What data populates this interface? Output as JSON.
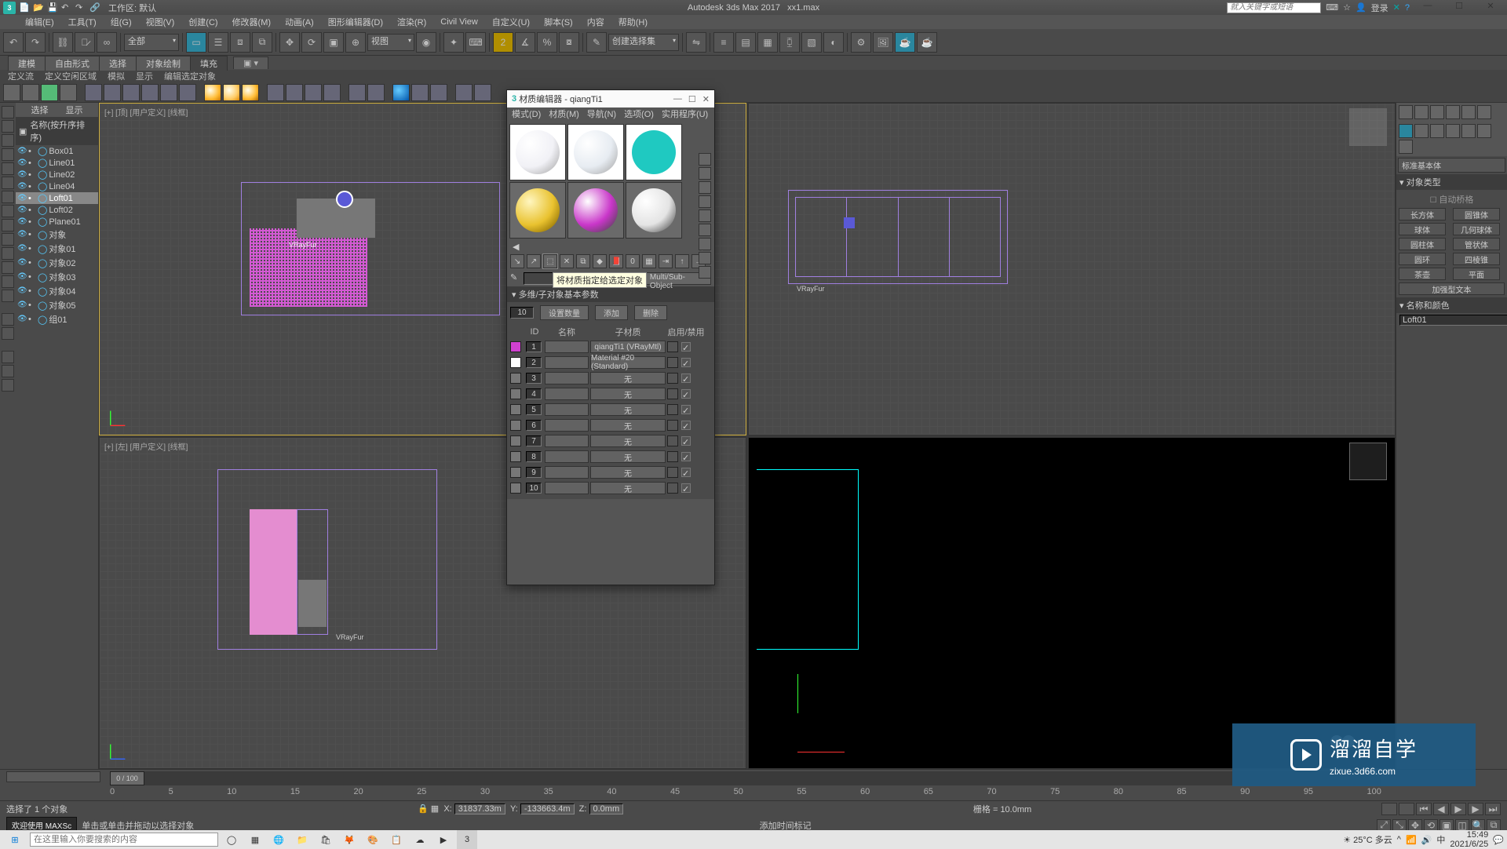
{
  "app": {
    "title": "Autodesk 3ds Max 2017",
    "filename": "xx1.max",
    "workspace_label": "工作区: 默认",
    "search_placeholder": "就入关键字或短语",
    "login_label": "登录"
  },
  "menu": [
    "编辑(E)",
    "工具(T)",
    "组(G)",
    "视图(V)",
    "创建(C)",
    "修改器(M)",
    "动画(A)",
    "图形编辑器(D)",
    "渲染(R)",
    "Civil View",
    "自定义(U)",
    "脚本(S)",
    "内容",
    "帮助(H)"
  ],
  "toolbar_dropdowns": {
    "filter": "全部",
    "viewmode": "视图",
    "create_select": "创建选择集"
  },
  "tabs": {
    "items": [
      "建模",
      "自由形式",
      "选择",
      "对象绘制",
      "填充"
    ],
    "active_index": 4
  },
  "subtabs": [
    "定义流",
    "定义空闲区域",
    "模拟",
    "显示",
    "编辑选定对象"
  ],
  "scene": {
    "col_select": "选择",
    "col_display": "显示",
    "sort_title": "名称(按升序排序)",
    "items": [
      {
        "name": "Box01",
        "sel": false
      },
      {
        "name": "Line01",
        "sel": false
      },
      {
        "name": "Line02",
        "sel": false
      },
      {
        "name": "Line04",
        "sel": false
      },
      {
        "name": "Loft01",
        "sel": true
      },
      {
        "name": "Loft02",
        "sel": false
      },
      {
        "name": "Plane01",
        "sel": false
      },
      {
        "name": "对象",
        "sel": false
      },
      {
        "name": "对象01",
        "sel": false
      },
      {
        "name": "对象02",
        "sel": false
      },
      {
        "name": "对象03",
        "sel": false
      },
      {
        "name": "对象04",
        "sel": false
      },
      {
        "name": "对象05",
        "sel": false
      },
      {
        "name": "组01",
        "sel": false
      }
    ]
  },
  "viewports": {
    "top": "[+] [顶] [用户定义] [线框]",
    "left": "[+] [左] [用户定义] [线框]",
    "fur_label": "VRayFur"
  },
  "command_panel": {
    "category": "标准基本体",
    "rollout1": "对象类型",
    "autogrid": "自动桥格",
    "buttons_col1": [
      "长方体",
      "球体",
      "圆柱体",
      "圆环",
      "茶壶",
      "加强型文本"
    ],
    "buttons_col2": [
      "圆锥体",
      "几何球体",
      "管状体",
      "四棱锥",
      "平面"
    ],
    "rollout2": "名称和颜色",
    "object_name": "Loft01",
    "object_color": "#ff3fbf"
  },
  "material_editor": {
    "title": "材质编辑器 - qiangTi1",
    "menu": [
      "模式(D)",
      "材质(M)",
      "导航(N)",
      "选项(O)",
      "实用程序(U)"
    ],
    "slots": [
      {
        "type": "sphere",
        "bg": "#ffffff",
        "color": "#f1f1f6"
      },
      {
        "type": "sphere",
        "bg": "#ffffff",
        "color": "#e7ecf2"
      },
      {
        "type": "flat",
        "bg": "#ffffff",
        "color": "#1fc9c1"
      },
      {
        "type": "sphere",
        "bg": "#6a6a6a",
        "color": "#e9c22f",
        "pattern": true
      },
      {
        "type": "sphere",
        "bg": "#6a6a6a",
        "color": "#c936c9"
      },
      {
        "type": "sphere",
        "bg": "#6a6a6a",
        "color": "#e4e4e4"
      }
    ],
    "tooltip": "将材质指定给选定对象",
    "type_button": "Multi/Sub-Object",
    "rollout_params": "多维/子对象基本参数",
    "num_subs": "10",
    "btn_setcount": "设置数量",
    "btn_add": "添加",
    "btn_delete": "删除",
    "th_id": "ID",
    "th_name": "名称",
    "th_submat": "子材质",
    "th_enable": "启用/禁用",
    "rows": [
      {
        "id": "1",
        "name": "",
        "sub": "qiangTi1 (VRayMtl)",
        "sw": "#d041d0",
        "enabled": true
      },
      {
        "id": "2",
        "name": "",
        "sub": "Material #20 (Standard)",
        "sw": "#ffffff",
        "enabled": true
      },
      {
        "id": "3",
        "name": "",
        "sub": "无",
        "sw": "#777777",
        "enabled": true
      },
      {
        "id": "4",
        "name": "",
        "sub": "无",
        "sw": "#777777",
        "enabled": true
      },
      {
        "id": "5",
        "name": "",
        "sub": "无",
        "sw": "#777777",
        "enabled": true
      },
      {
        "id": "6",
        "name": "",
        "sub": "无",
        "sw": "#777777",
        "enabled": true
      },
      {
        "id": "7",
        "name": "",
        "sub": "无",
        "sw": "#777777",
        "enabled": true
      },
      {
        "id": "8",
        "name": "",
        "sub": "无",
        "sw": "#777777",
        "enabled": true
      },
      {
        "id": "9",
        "name": "",
        "sub": "无",
        "sw": "#777777",
        "enabled": true
      },
      {
        "id": "10",
        "name": "",
        "sub": "无",
        "sw": "#777777",
        "enabled": true
      }
    ]
  },
  "timeline": {
    "pos_label": "0 / 100",
    "ticks": [
      "0",
      "5",
      "10",
      "15",
      "20",
      "25",
      "30",
      "35",
      "40",
      "45",
      "50",
      "55",
      "60",
      "65",
      "70",
      "75",
      "80",
      "85",
      "90",
      "95",
      "100"
    ]
  },
  "status": {
    "selection": "选择了 1 个对象",
    "welcome": "欢迎使用 MAXSc",
    "hint": "单击或单击并拖动以选择对象",
    "x_label": "X:",
    "y_label": "Y:",
    "z_label": "Z:",
    "x": "31837.33m",
    "y": "-133663.4m",
    "z": "0.0mm",
    "grid": "栅格 = 10.0mm",
    "addkey": "添加时间标记"
  },
  "watermark": {
    "brand": "溜溜自学",
    "url": "zixue.3d66.com"
  },
  "taskbar": {
    "search_placeholder": "在这里输入你要搜索的内容",
    "weather": "25°C 多云",
    "time": "15:49",
    "date": "2021/6/25"
  }
}
